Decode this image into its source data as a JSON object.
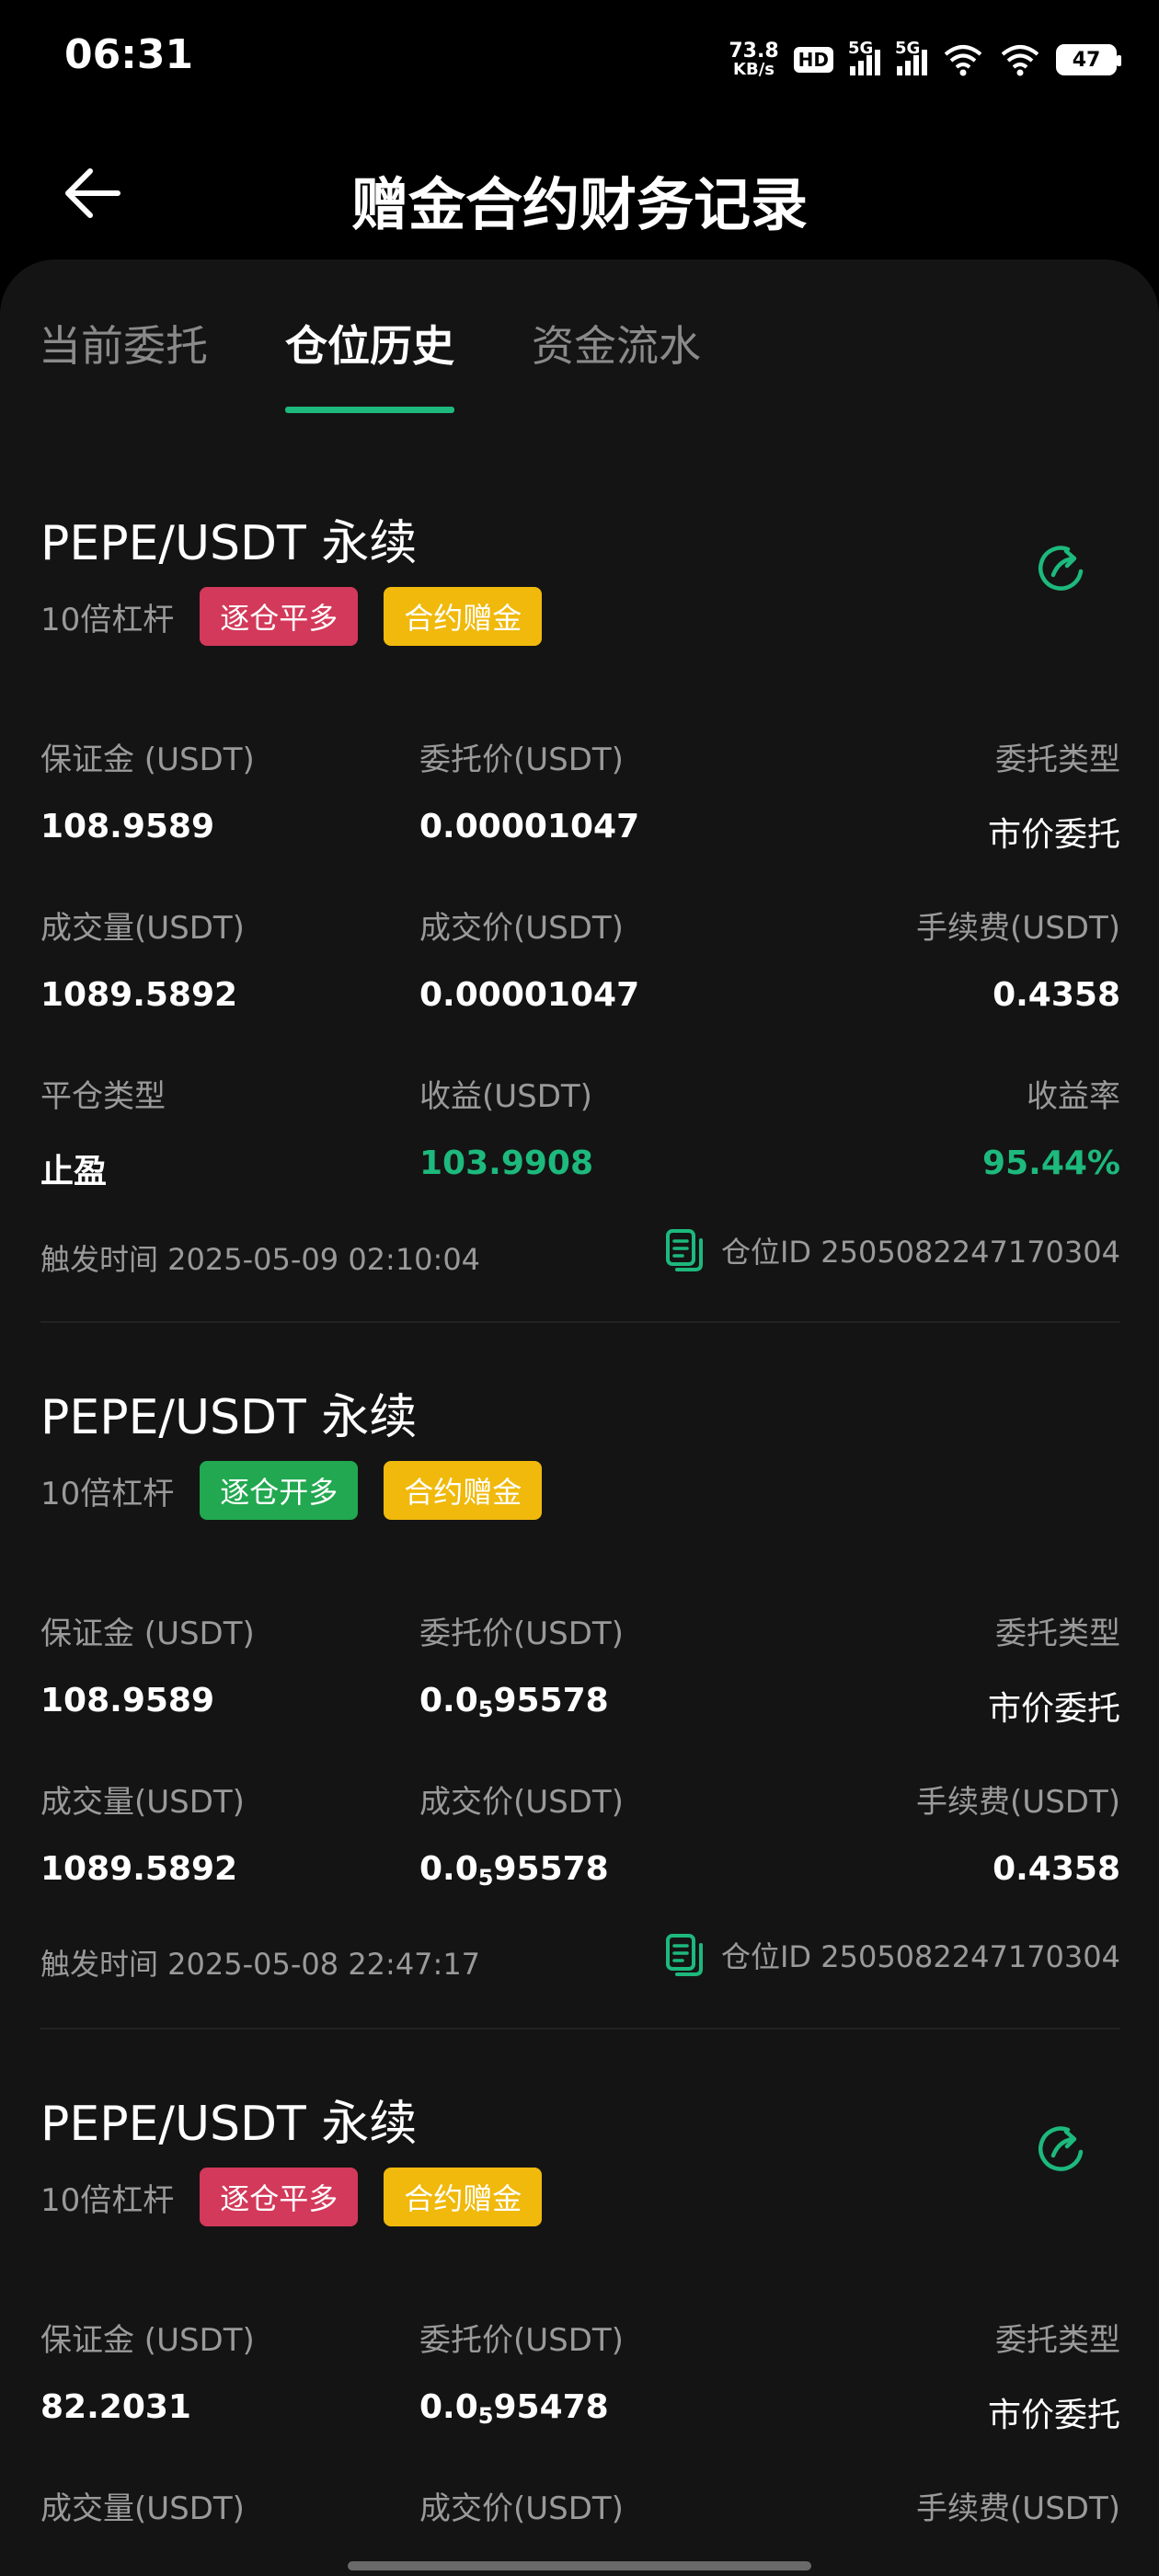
{
  "status_bar": {
    "time": "06:31",
    "net_speed_value": "73.8",
    "net_speed_unit": "KB/s",
    "hd_label": "HD",
    "sim1_label": "5G",
    "sim2_label": "5G",
    "battery": "47"
  },
  "header": {
    "title": "赠金合约财务记录",
    "back_icon": "arrow-left-icon"
  },
  "tabs": [
    {
      "label": "当前委托",
      "active": false
    },
    {
      "label": "仓位历史",
      "active": true
    },
    {
      "label": "资金流水",
      "active": false
    }
  ],
  "colors": {
    "accent_green": "#1db97d",
    "tag_red": "#d3395a",
    "tag_green": "#22a850",
    "tag_gold": "#f0b90b"
  },
  "cards": [
    {
      "pair": "PEPE/USDT 永续",
      "leverage": "10倍杠杆",
      "side_tag": "逐仓平多",
      "bonus_tag": "合约赠金",
      "labels": {
        "margin": "保证金 (USDT)",
        "order_price": "委托价(USDT)",
        "order_type": "委托类型",
        "volume": "成交量(USDT)",
        "fill_price": "成交价(USDT)",
        "fee": "手续费(USDT)",
        "close_type": "平仓类型",
        "pnl": "收益(USDT)",
        "pnl_rate": "收益率"
      },
      "values": {
        "margin": "108.9589",
        "order_price": "0.00001047",
        "order_type": "市价委托",
        "volume": "1089.5892",
        "fill_price": "0.00001047",
        "fee": "0.4358",
        "close_type": "止盈",
        "pnl": "103.9908",
        "pnl_rate": "95.44%"
      },
      "trigger_time": "触发时间 2025-05-09 02:10:04",
      "position_id": "仓位ID 2505082247170304"
    },
    {
      "pair": "PEPE/USDT 永续",
      "leverage": "10倍杠杆",
      "side_tag": "逐仓开多",
      "bonus_tag": "合约赠金",
      "labels": {
        "margin": "保证金 (USDT)",
        "order_price": "委托价(USDT)",
        "order_type": "委托类型",
        "volume": "成交量(USDT)",
        "fill_price": "成交价(USDT)",
        "fee": "手续费(USDT)"
      },
      "values": {
        "margin": "108.9589",
        "order_price_prefix": "0.0",
        "order_price_sub": "5",
        "order_price_rest": "95578",
        "order_type": "市价委托",
        "volume": "1089.5892",
        "fill_price_prefix": "0.0",
        "fill_price_sub": "5",
        "fill_price_rest": "95578",
        "fee": "0.4358"
      },
      "trigger_time": "触发时间 2025-05-08 22:47:17",
      "position_id": "仓位ID 2505082247170304"
    },
    {
      "pair": "PEPE/USDT 永续",
      "leverage": "10倍杠杆",
      "side_tag": "逐仓平多",
      "bonus_tag": "合约赠金",
      "labels": {
        "margin": "保证金 (USDT)",
        "order_price": "委托价(USDT)",
        "order_type": "委托类型",
        "volume": "成交量(USDT)",
        "fill_price": "成交价(USDT)",
        "fee": "手续费(USDT)"
      },
      "values": {
        "margin": "82.2031",
        "order_price_prefix": "0.0",
        "order_price_sub": "5",
        "order_price_rest": "95478",
        "order_type": "市价委托"
      }
    }
  ]
}
